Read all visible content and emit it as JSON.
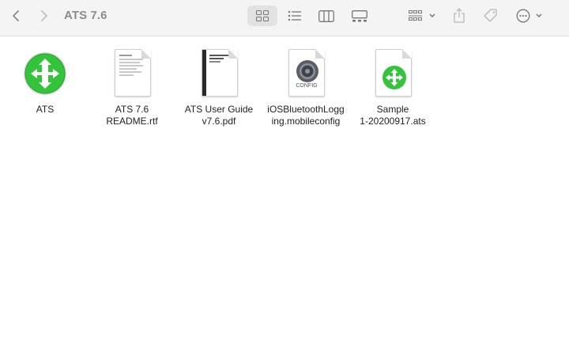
{
  "window": {
    "title": "ATS 7.6"
  },
  "toolbar": {
    "back_icon": "chevron-left-icon",
    "forward_icon": "chevron-right-icon",
    "view_icons": "grid-view-icon",
    "view_list": "list-view-icon",
    "view_columns": "column-view-icon",
    "view_gallery": "gallery-view-icon",
    "group_by": "group-by-icon",
    "share": "share-icon",
    "tag": "tag-icon",
    "more": "ellipsis-circle-icon"
  },
  "files": [
    {
      "line1": "ATS",
      "line2": "",
      "icon": "ats-app-icon"
    },
    {
      "line1": "ATS 7.6",
      "line2": "README.rtf",
      "icon": "rtf-document-icon"
    },
    {
      "line1": "ATS User Guide",
      "line2": "v7.6.pdf",
      "icon": "pdf-document-icon"
    },
    {
      "line1": "iOSBluetoothLogg",
      "line2": "ing.mobileconfig",
      "icon": "config-profile-icon",
      "badge": "CONFIG"
    },
    {
      "line1": "Sample",
      "line2": "1-20200917.ats",
      "icon": "ats-document-icon"
    }
  ],
  "colors": {
    "accent_green": "#33c43b",
    "toolbar_bg": "#f4f4f4"
  }
}
